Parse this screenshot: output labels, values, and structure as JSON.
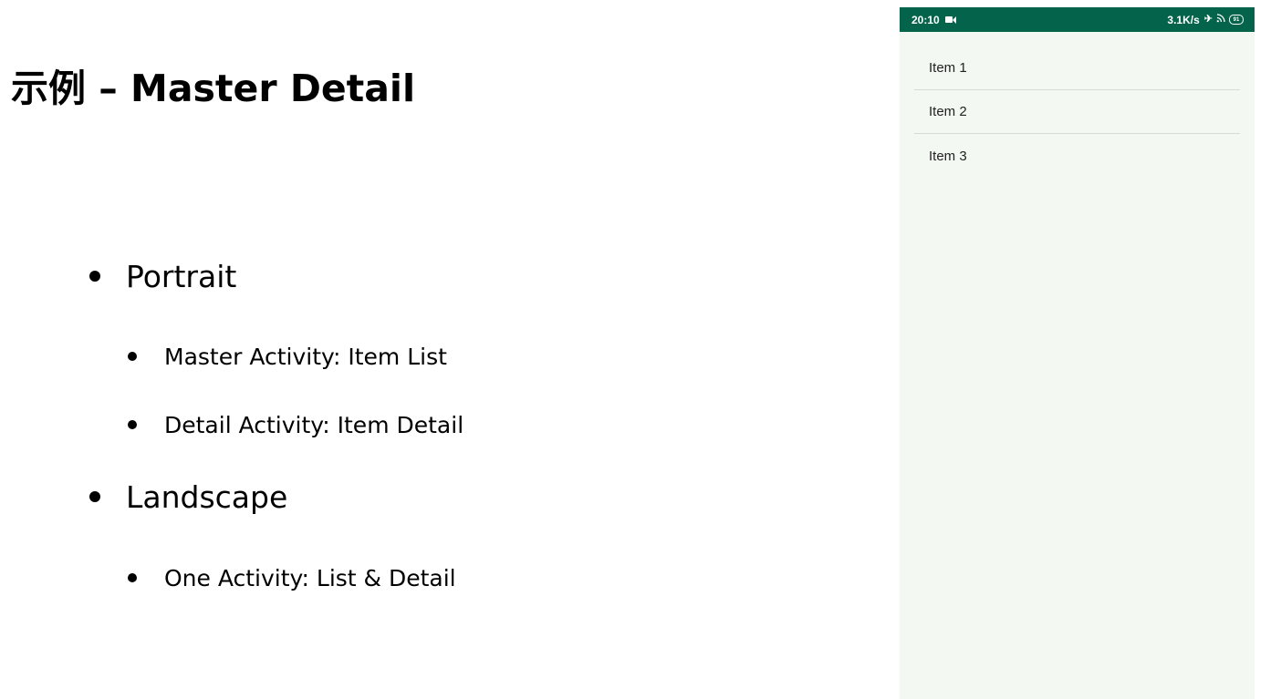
{
  "slide": {
    "title": "示例 – Master Detail",
    "bullets": [
      {
        "text": "Portrait",
        "children": [
          "Master Activity: Item List",
          "Detail Activity: Item Detail"
        ]
      },
      {
        "text": "Landscape",
        "children": [
          "One Activity: List & Detail"
        ]
      }
    ]
  },
  "phone": {
    "status_bar": {
      "time": "20:10",
      "net_speed": "3.1K/s",
      "battery": "91",
      "icons": [
        "video-camera-icon",
        "airplane-mode-icon",
        "wifi-icon",
        "battery-icon"
      ]
    },
    "items": [
      "Item 1",
      "Item 2",
      "Item 3"
    ]
  },
  "colors": {
    "status_bar_bg": "#03644b",
    "phone_bg": "#f3f8f3",
    "divider": "#d6dbd6"
  }
}
